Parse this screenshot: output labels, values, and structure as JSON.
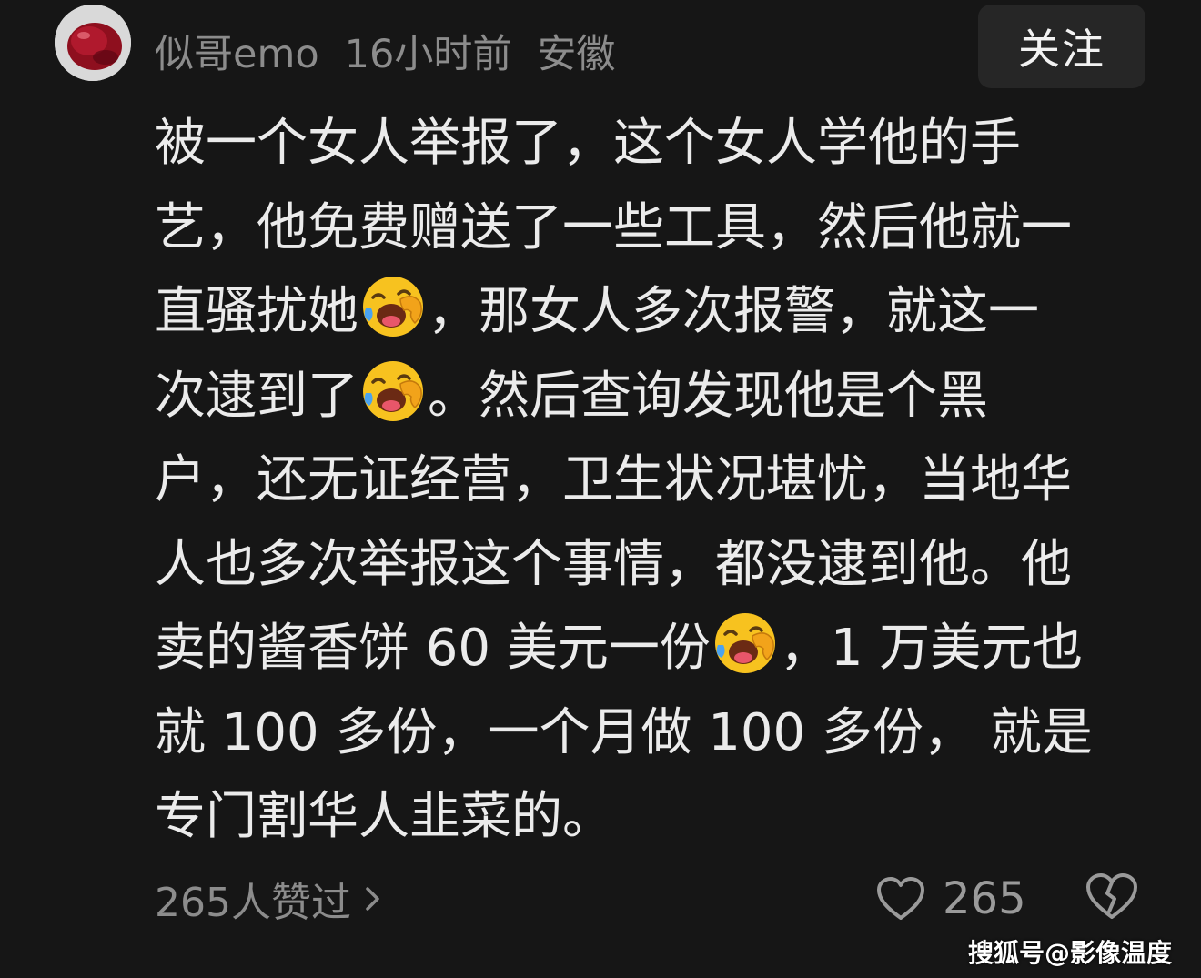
{
  "header": {
    "username": "似哥emo",
    "time_ago": "16小时前",
    "location": "安徽",
    "follow_label": "关注",
    "avatar_icon": "red-apple-avatar"
  },
  "comment": {
    "lines": [
      "被一个女人举报了，这个女人学他的手",
      "艺，他免费赠送了一些工具，然后他就一",
      {
        "before": "直骚扰她",
        "emoji": "laughing-crying-emoji",
        "after": "，那女人多次报警，就这一"
      },
      {
        "before": "次逮到了",
        "emoji": "laughing-crying-emoji",
        "after": "。然后查询发现他是个黑"
      },
      "户，还无证经营，卫生状况堪忧，当地华",
      "人也多次举报这个事情，都没逮到他。他",
      {
        "before": "卖的酱香饼 60 美元一份",
        "emoji": "laughing-crying-emoji",
        "after": "，1 万美元也"
      },
      "就 100 多份，一个月做 100 多份， 就是",
      "专门割华人韭菜的。"
    ]
  },
  "footer": {
    "likes_summary": "265人赞过",
    "like_count": "265",
    "like_icon": "heart-outline-icon",
    "dislike_icon": "broken-heart-icon",
    "chevron_icon": "chevron-right-icon"
  },
  "watermark": "搜狐号@影像温度",
  "colors": {
    "background": "#161616",
    "text": "#ebebeb",
    "muted": "#8c8c8c",
    "button_bg": "#262626"
  }
}
